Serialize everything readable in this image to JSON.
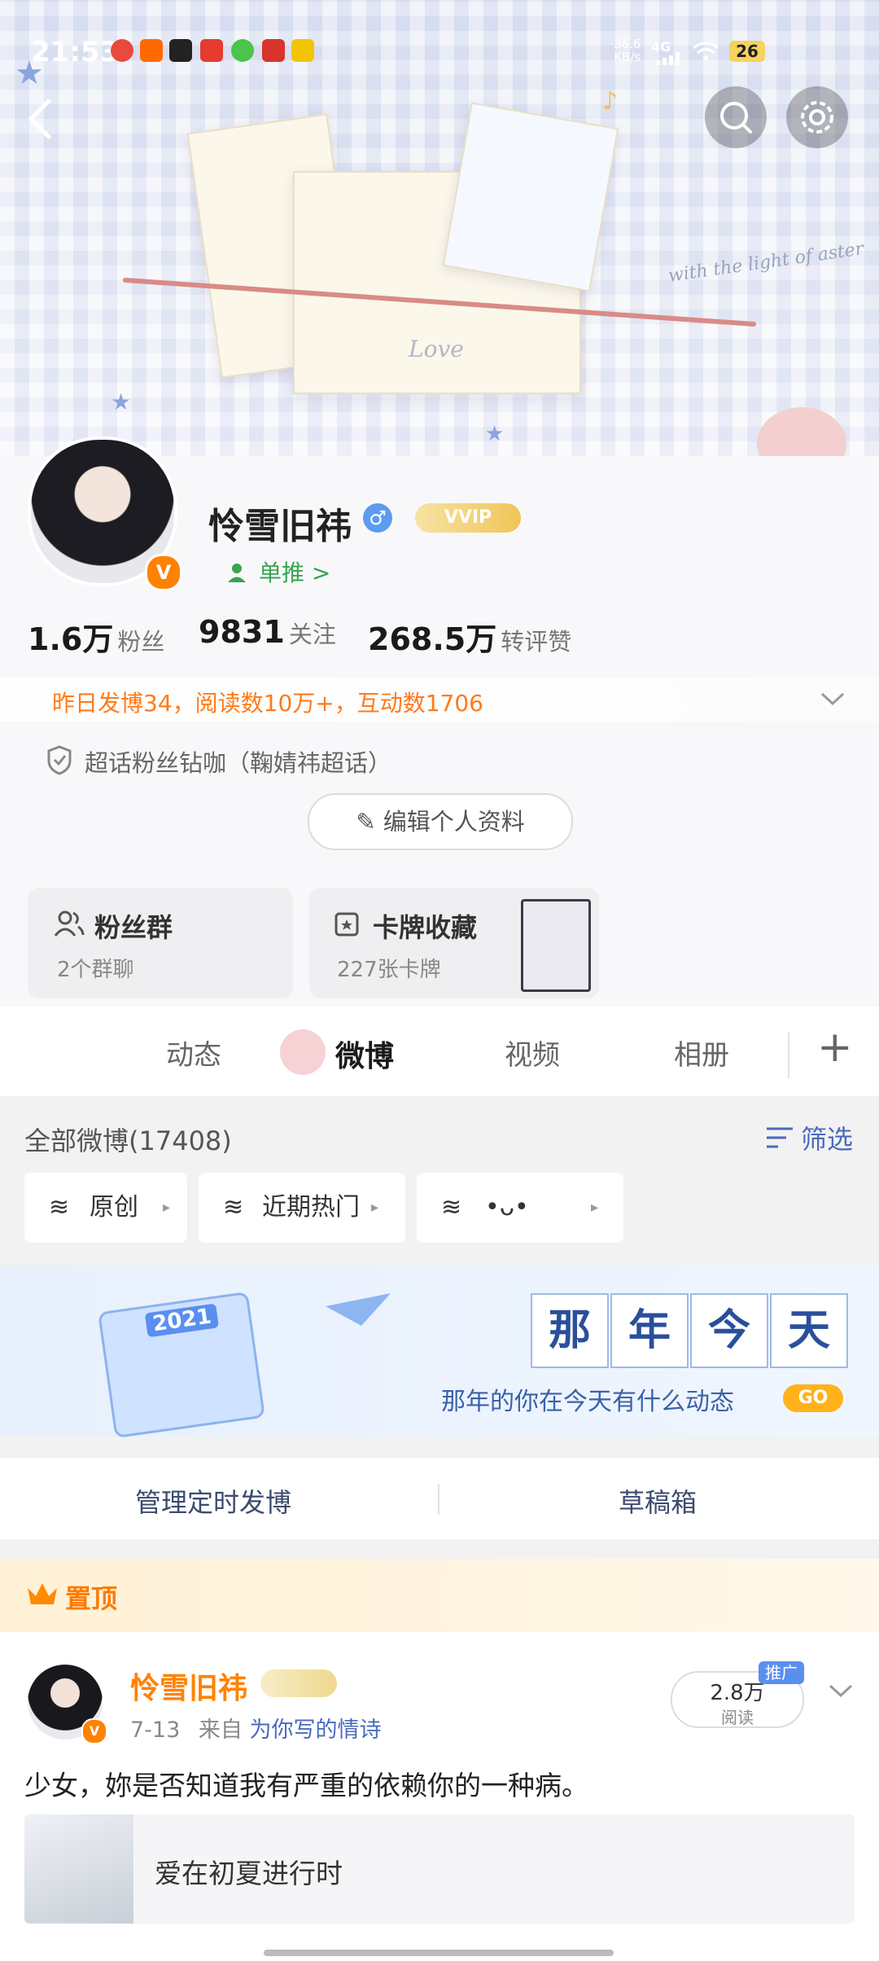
{
  "status_bar": {
    "time": "21:53",
    "net_speed": "36.6",
    "net_unit": "KB/s",
    "signal": "4G",
    "battery": "26"
  },
  "profile": {
    "name": "怜雪旧祎",
    "vip_label": "VVIP",
    "recommend_label": "单推 >",
    "stats": [
      {
        "num": "1.6万",
        "label": "粉丝"
      },
      {
        "num": "9831",
        "label": "关注"
      },
      {
        "num": "268.5万",
        "label": "转评赞"
      }
    ],
    "yesterday": "昨日发博34，阅读数10万+，互动数1706",
    "superfan": "超话粉丝钻咖（鞠婧祎超话）",
    "edit_button": "编辑个人资料"
  },
  "cards": [
    {
      "title": "粉丝群",
      "sub": "2个群聊"
    },
    {
      "title": "卡牌收藏",
      "sub": "227张卡牌"
    }
  ],
  "tabs": [
    "动态",
    "微博",
    "视频",
    "相册"
  ],
  "list": {
    "all_label": "全部微博(17408)",
    "filter_label": "筛选",
    "chips": [
      "原创",
      "近期热门",
      "•ᴗ•"
    ]
  },
  "memory": {
    "chars": [
      "那",
      "年",
      "今",
      "天"
    ],
    "subtitle": "那年的你在今天有什么动态",
    "go": "GO",
    "calendar_year": "2021"
  },
  "actions": {
    "scheduled": "管理定时发博",
    "drafts": "草稿箱"
  },
  "pinned": {
    "label": "置顶"
  },
  "post": {
    "author": "怜雪旧祎",
    "date": "7-13",
    "from_prefix": "来自",
    "source": "为你写的情诗",
    "reads_num": "2.8万",
    "reads_label": "阅读",
    "promo": "推广",
    "text": "少女，妳是否知道我有严重的依赖你的一种病。",
    "link_title": "爱在初夏进行时"
  },
  "banner": {
    "script_text_1": "with the light of aster",
    "script_text_2": "Love"
  },
  "colors": {
    "accent_orange": "#ff8200",
    "link_blue": "#4a6ac0",
    "green": "#3aa350"
  }
}
